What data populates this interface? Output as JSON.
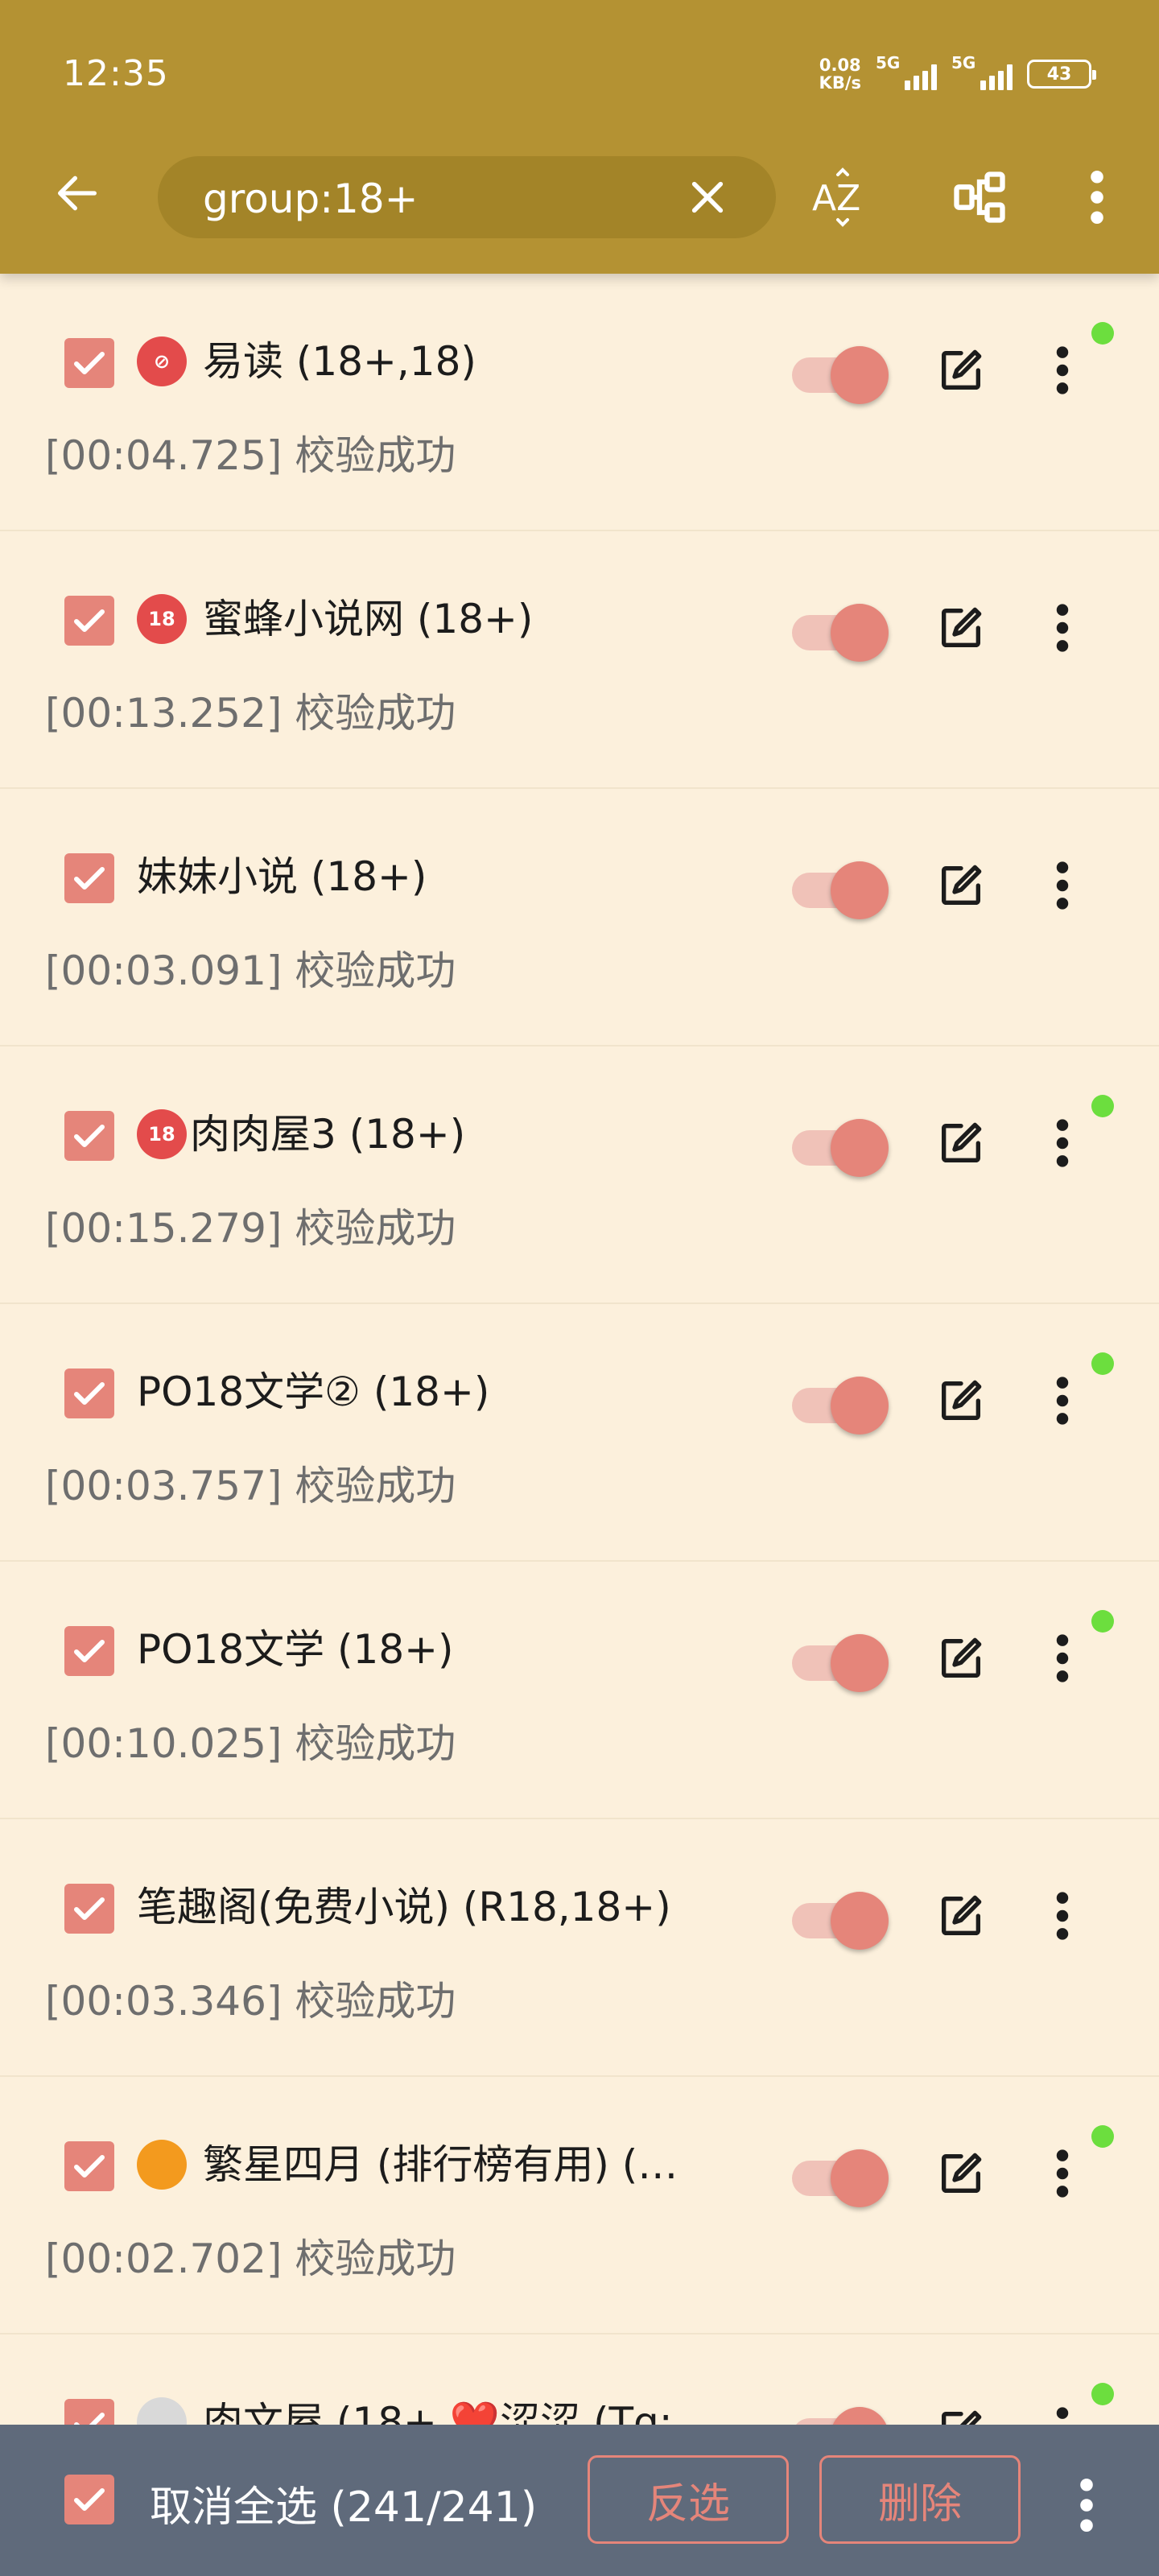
{
  "status_bar": {
    "time": "12:35",
    "net_speed_value": "0.08",
    "net_speed_unit": "KB/s",
    "sim1": "5G",
    "sim2": "5G",
    "battery": "43"
  },
  "toolbar": {
    "search_value": "group:18+",
    "sort_label": "AZ"
  },
  "sources": [
    {
      "emoji": "🚭",
      "name": "易读 (18+,18)",
      "info": "[00:04.725] 校验成功",
      "enabled": true,
      "new": true
    },
    {
      "emoji": "🔞",
      "name": "蜜蜂小说网 (18+)",
      "info": "[00:13.252] 校验成功",
      "enabled": true,
      "new": false
    },
    {
      "emoji": "",
      "name": "妹妹小说 (18+)",
      "info": "[00:03.091] 校验成功",
      "enabled": true,
      "new": false
    },
    {
      "emoji": "🔞",
      "name": "肉肉屋3 (18+)",
      "info": "[00:15.279] 校验成功",
      "enabled": true,
      "new": true
    },
    {
      "emoji": "",
      "name": "PO18文学② (18+)",
      "info": "[00:03.757] 校验成功",
      "enabled": true,
      "new": true
    },
    {
      "emoji": "",
      "name": "PO18文学 (18+)",
      "info": "[00:10.025] 校验成功",
      "enabled": true,
      "new": true
    },
    {
      "emoji": "",
      "name": "笔趣阁(免费小说) (R18,18+)",
      "info": "[00:03.346] 校验成功",
      "enabled": true,
      "new": false
    },
    {
      "emoji": "🍊",
      "name": "繁星四月 (排行榜有用) (…",
      "info": "[00:02.702] 校验成功",
      "enabled": true,
      "new": true
    },
    {
      "emoji": "🌙",
      "name": "肉文屋 (18+,❤️涩涩 (Tg:",
      "info": "",
      "enabled": true,
      "new": true
    }
  ],
  "bottom_bar": {
    "select_label": "取消全选 (241/241)",
    "invert_label": "反选",
    "delete_label": "删除"
  },
  "colors": {
    "appbar": "#b49233",
    "background": "#fcf0dc",
    "accent": "#e5857a",
    "bottom_bar": "#5f6a7b",
    "new_dot": "#6cde3e"
  }
}
